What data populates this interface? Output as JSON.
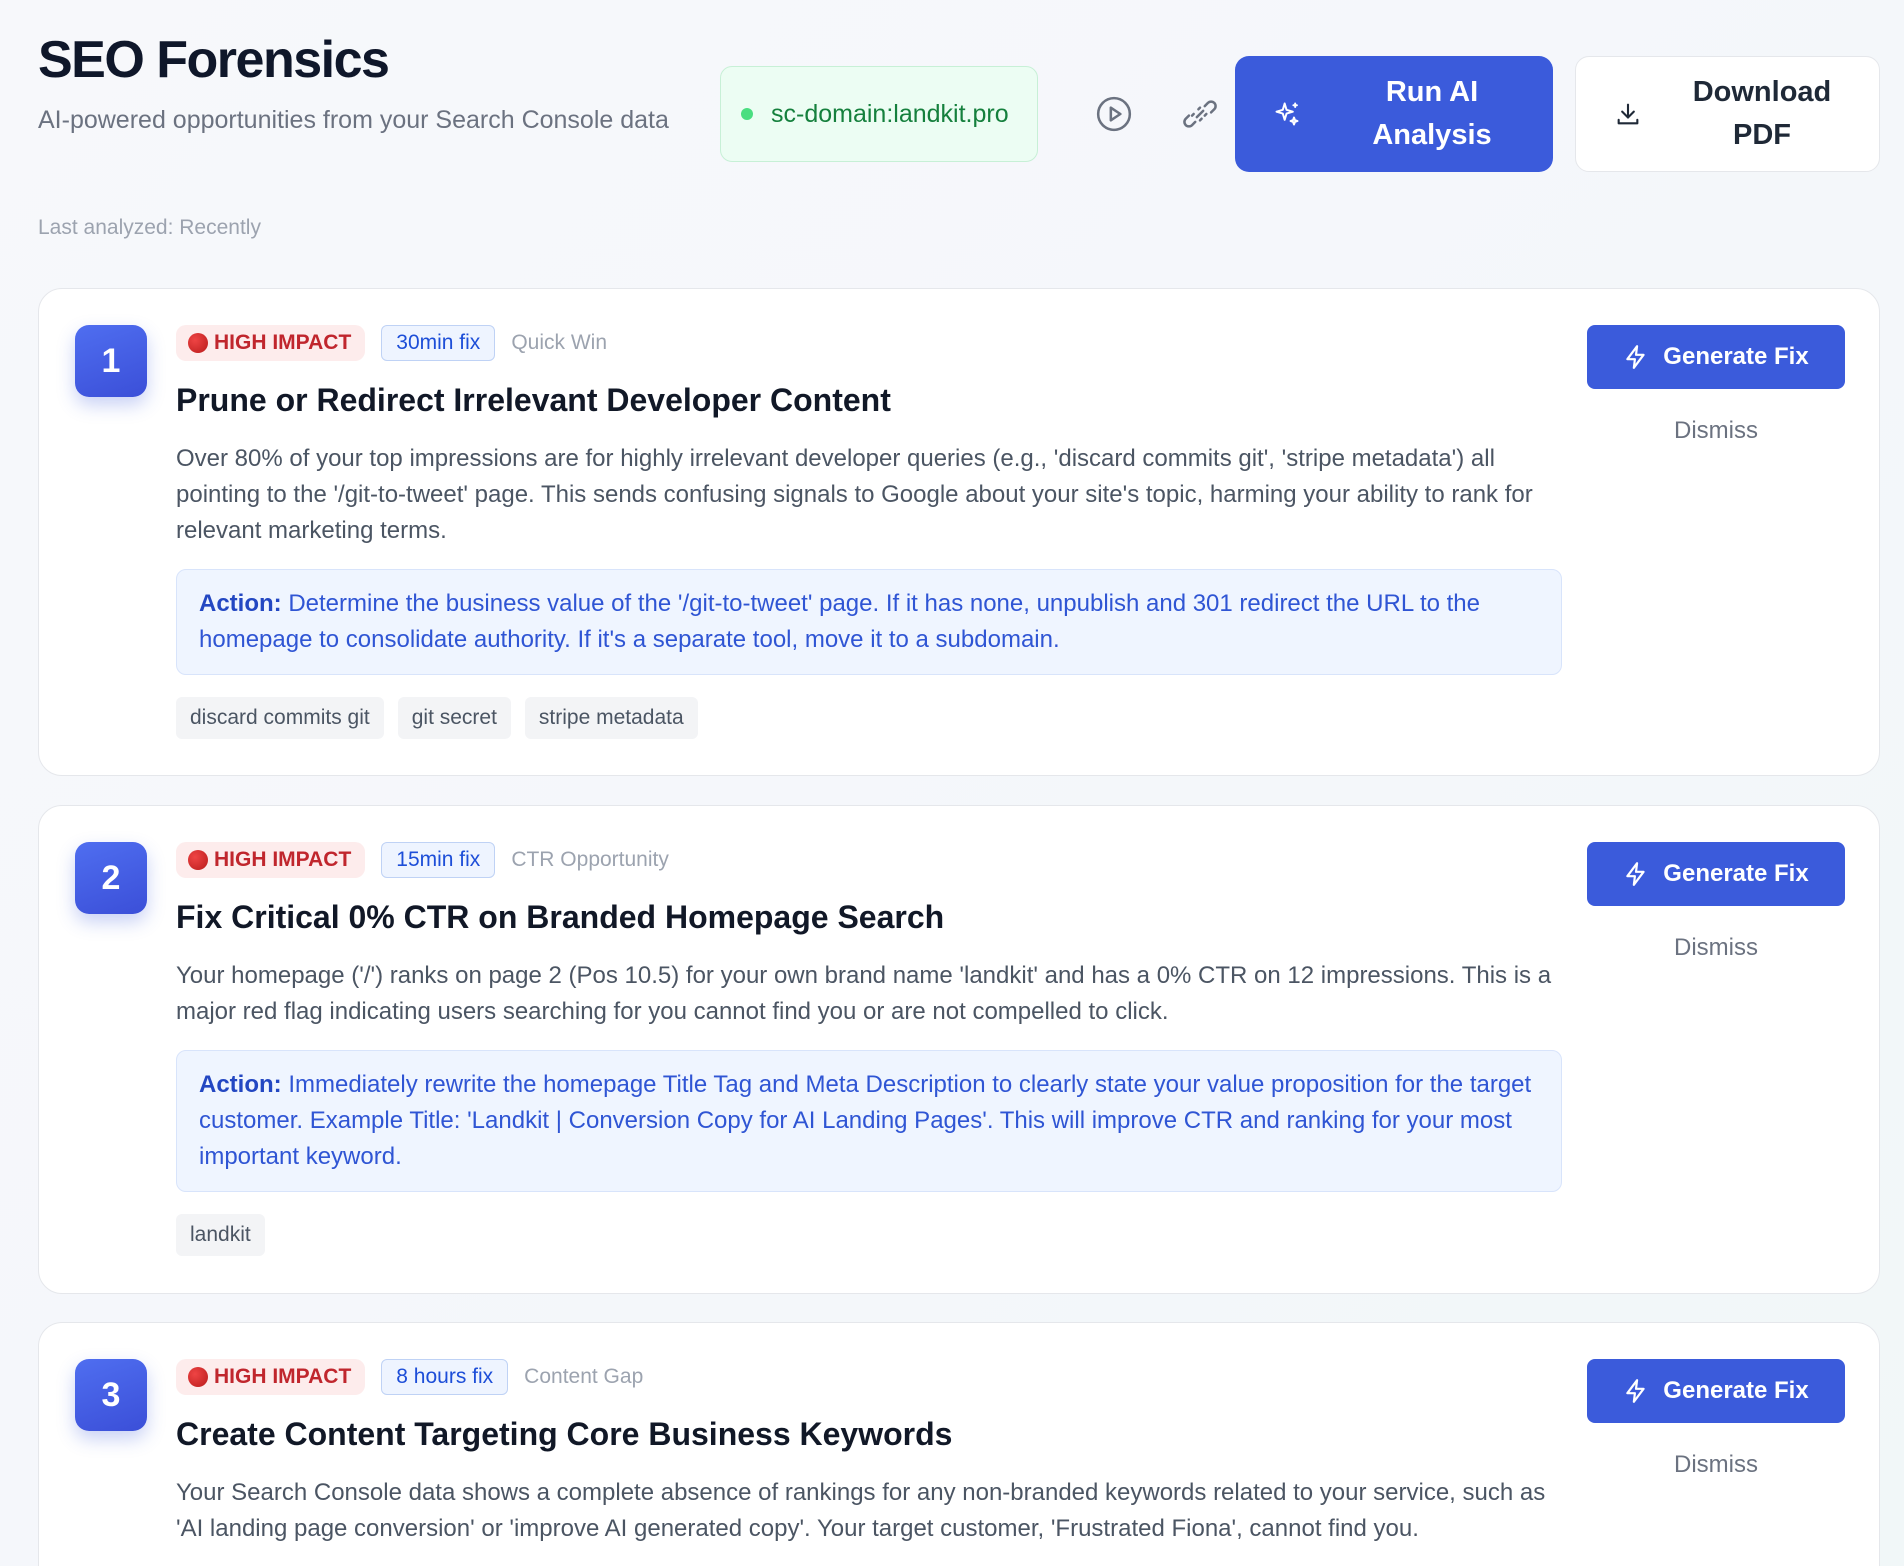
{
  "header": {
    "title": "SEO Forensics",
    "subtitle": "AI-powered opportunities from your Search Console data",
    "domain": "sc-domain:landkit.pro",
    "run_label": "Run AI Analysis",
    "pdf_label": "Download PDF",
    "last_analyzed": "Last analyzed: Recently"
  },
  "colors": {
    "accent": "#3b5bdb",
    "impact_red": "#c0262d",
    "domain_green": "#15803d"
  },
  "icons": {
    "play": "play-circle-icon",
    "link": "unlink-icon",
    "sparkle": "sparkles-icon",
    "download": "download-icon",
    "bolt": "lightning-bolt-icon"
  },
  "cards": [
    {
      "number": "1",
      "impact": "HIGH IMPACT",
      "time": "30min fix",
      "category": "Quick Win",
      "title": "Prune or Redirect Irrelevant Developer Content",
      "description": "Over 80% of your top impressions are for highly irrelevant developer queries (e.g., 'discard commits git', 'stripe metadata') all pointing to the '/git-to-tweet' page. This sends confusing signals to Google about your site's topic, harming your ability to rank for relevant marketing terms.",
      "action_label": "Action:",
      "action": "Determine the business value of the '/git-to-tweet' page. If it has none, unpublish and 301 redirect the URL to the homepage to consolidate authority. If it's a separate tool, move it to a subdomain.",
      "tags": [
        "discard commits git",
        "git secret",
        "stripe metadata"
      ],
      "generate_label": "Generate Fix",
      "dismiss_label": "Dismiss"
    },
    {
      "number": "2",
      "impact": "HIGH IMPACT",
      "time": "15min fix",
      "category": "CTR Opportunity",
      "title": "Fix Critical 0% CTR on Branded Homepage Search",
      "description": "Your homepage ('/') ranks on page 2 (Pos 10.5) for your own brand name 'landkit' and has a 0% CTR on 12 impressions. This is a major red flag indicating users searching for you cannot find you or are not compelled to click.",
      "action_label": "Action:",
      "action": "Immediately rewrite the homepage Title Tag and Meta Description to clearly state your value proposition for the target customer. Example Title: 'Landkit | Conversion Copy for AI Landing Pages'. This will improve CTR and ranking for your most important keyword.",
      "tags": [
        "landkit"
      ],
      "generate_label": "Generate Fix",
      "dismiss_label": "Dismiss"
    },
    {
      "number": "3",
      "impact": "HIGH IMPACT",
      "time": "8 hours fix",
      "category": "Content Gap",
      "title": "Create Content Targeting Core Business Keywords",
      "description": "Your Search Console data shows a complete absence of rankings for any non-branded keywords related to your service, such as 'AI landing page conversion' or 'improve AI generated copy'. Your target customer, 'Frustrated Fiona', cannot find you.",
      "generate_label": "Generate Fix",
      "dismiss_label": "Dismiss"
    }
  ]
}
